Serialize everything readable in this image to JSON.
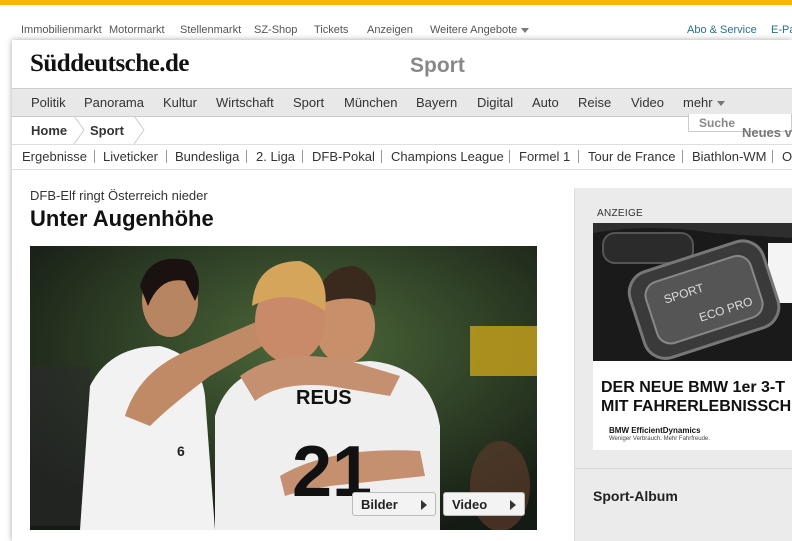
{
  "topnav": {
    "items": [
      "Immobilienmarkt",
      "Motormarkt",
      "Stellenmarkt",
      "SZ-Shop",
      "Tickets",
      "Anzeigen",
      "Weitere Angebote"
    ],
    "right": [
      "Abo & Service",
      "E-Pa"
    ]
  },
  "masthead": {
    "logo": "Süddeutsche.de",
    "section": "Sport"
  },
  "mainnav": {
    "items": [
      "Politik",
      "Panorama",
      "Kultur",
      "Wirtschaft",
      "Sport",
      "München",
      "Bayern",
      "Digital",
      "Auto",
      "Reise",
      "Video",
      "mehr"
    ]
  },
  "breadcrumb": {
    "items": [
      "Home",
      "Sport"
    ]
  },
  "search": {
    "placeholder": "Suche"
  },
  "neues": "Neues v",
  "subnav": {
    "items": [
      "Ergebnisse",
      "Liveticker",
      "Bundesliga",
      "2. Liga",
      "DFB-Pokal",
      "Champions League",
      "Formel 1",
      "Tour de France",
      "Biathlon-WM",
      "O"
    ]
  },
  "article": {
    "kicker": "DFB-Elf ringt Österreich nieder",
    "headline": "Unter Augenhöhe",
    "photo": {
      "jersey_name": "REUS",
      "jersey_number": "21",
      "player_number": "6"
    },
    "buttons": {
      "gallery": "Bilder",
      "video": "Video"
    }
  },
  "sidebar": {
    "ad_label": "ANZEIGE",
    "ad": {
      "button_top": "SPORT",
      "button_bottom": "ECO PRO",
      "headline_1": "DER NEUE BMW 1er 3-T",
      "headline_2": "MIT FAHRERLEBNISSCH",
      "brand": "BMW EfficientDynamics",
      "tagline": "Weniger Verbrauch. Mehr Fahrfreude."
    },
    "album_title": "Sport-Album"
  },
  "colors": {
    "accent": "#f7b600",
    "nav_bg": "#e8e8e8",
    "sidebar_bg": "#ebebeb"
  }
}
